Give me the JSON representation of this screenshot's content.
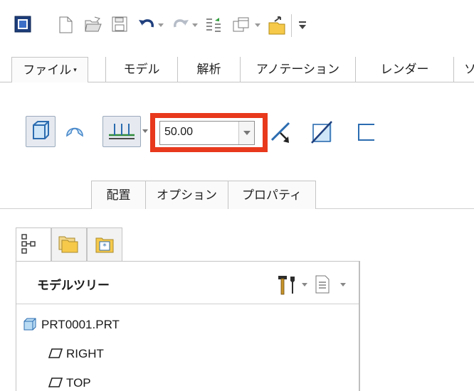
{
  "ribbon_tabs": [
    {
      "label": "ファイル",
      "caret": "▾"
    },
    {
      "label": "モデル"
    },
    {
      "label": "解析"
    },
    {
      "label": "アノテーション"
    },
    {
      "label": "レンダー"
    },
    {
      "label": "ソ"
    }
  ],
  "depth_field": {
    "value": "50.00"
  },
  "sub_tabs": [
    "配置",
    "オプション",
    "プロパティ"
  ],
  "panel": {
    "title": "モデルツリー"
  },
  "tree": [
    {
      "label": "PRT0001.PRT"
    },
    {
      "label": "RIGHT"
    },
    {
      "label": "TOP"
    }
  ],
  "colors": {
    "highlight": "#e8391d",
    "accent": "#2f7fd1"
  }
}
